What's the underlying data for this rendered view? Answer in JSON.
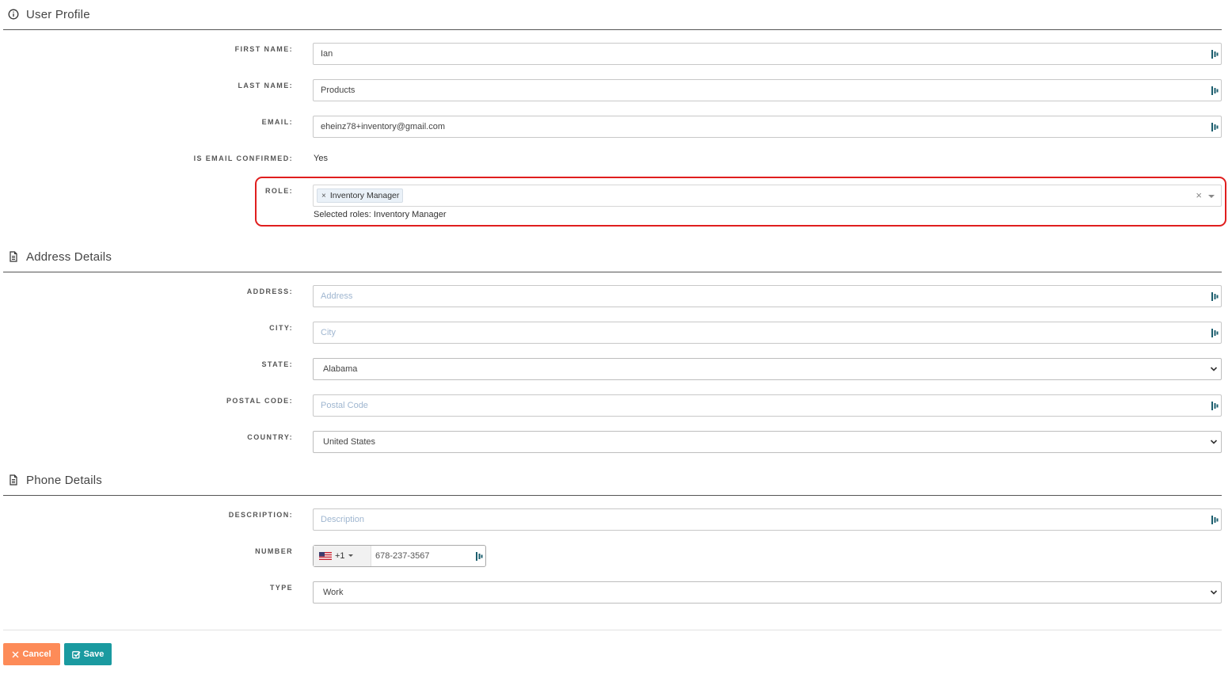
{
  "sections": {
    "user_profile": "User Profile",
    "address_details": "Address Details",
    "phone_details": "Phone Details"
  },
  "labels": {
    "first_name": "FIRST NAME:",
    "last_name": "LAST NAME:",
    "email": "EMAIL:",
    "is_email_confirmed": "IS EMAIL CONFIRMED:",
    "role": "ROLE:",
    "address": "ADDRESS:",
    "city": "CITY:",
    "state": "STATE:",
    "postal_code": "POSTAL CODE:",
    "country": "COUNTRY:",
    "description": "DESCRIPTION:",
    "number": "NUMBER",
    "type": "TYPE"
  },
  "values": {
    "first_name": "Ian",
    "last_name": "Products",
    "email": "eheinz78+inventory@gmail.com",
    "is_email_confirmed": "Yes",
    "role_tag": "Inventory Manager",
    "role_tag_remove": "×",
    "role_clear": "×",
    "selected_roles": "Selected roles: Inventory Manager",
    "state": "Alabama",
    "country": "United States",
    "phone_code": "+1",
    "phone_number": "678-237-3567",
    "type": "Work"
  },
  "placeholders": {
    "address": "Address",
    "city": "City",
    "postal_code": "Postal Code",
    "description": "Description"
  },
  "buttons": {
    "cancel": "Cancel",
    "save": "Save"
  },
  "colors": {
    "cancel": "#fd8b58",
    "save": "#1a9aa0",
    "highlight": "#e01e1e",
    "password_manager_icon": "#1b5e6e"
  },
  "icons": {
    "user_profile": "info-circle-icon",
    "address_details": "document-icon",
    "phone_details": "document-icon",
    "field_addon": "password-manager-icon",
    "cancel": "close-icon",
    "save": "check-square-icon"
  }
}
